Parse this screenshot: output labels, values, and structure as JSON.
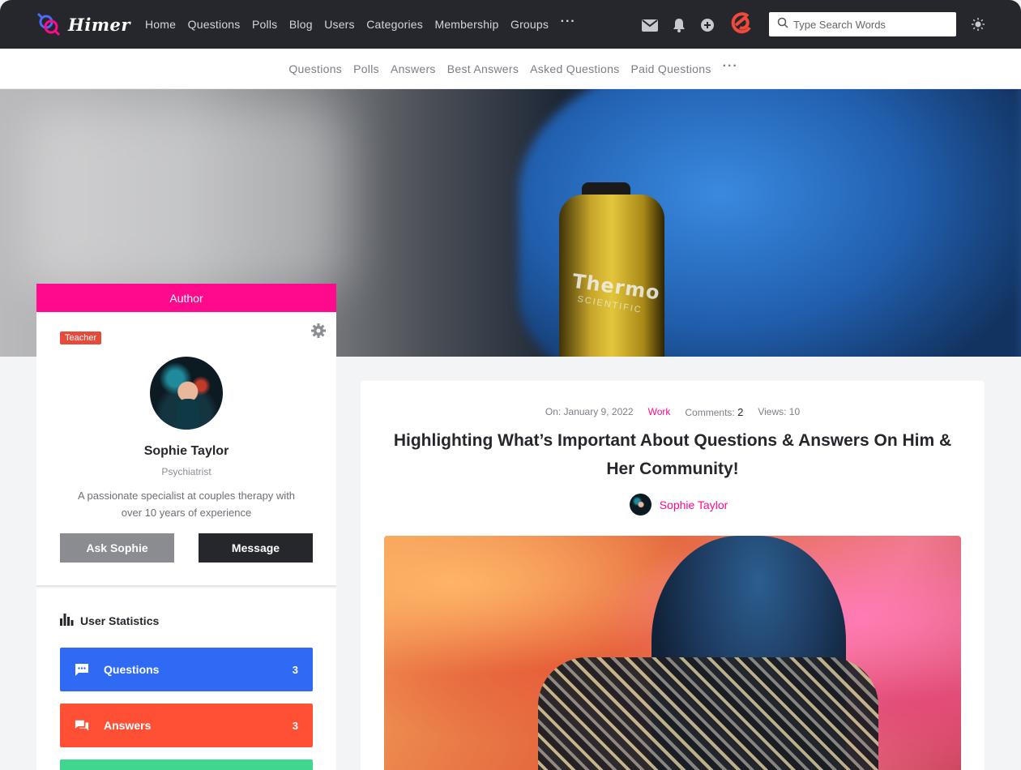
{
  "app": {
    "logo_text": "Himer"
  },
  "nav": {
    "items": [
      "Home",
      "Questions",
      "Polls",
      "Blog",
      "Users",
      "Categories",
      "Membership",
      "Groups"
    ],
    "more": "···"
  },
  "search": {
    "placeholder": "Type Search Words"
  },
  "subnav": {
    "items": [
      "Questions",
      "Polls",
      "Answers",
      "Best Answers",
      "Asked Questions",
      "Paid Questions"
    ],
    "more": "···"
  },
  "hero": {
    "bottle_label": "Thermo",
    "bottle_sublabel": "SCIENTIFIC"
  },
  "author": {
    "header": "Author",
    "badge": "Teacher",
    "name": "Sophie Taylor",
    "role": "Psychiatrist",
    "bio": "A passionate specialist at couples therapy with over 10 years of experience",
    "ask_label": "Ask Sophie",
    "message_label": "Message"
  },
  "stats": {
    "title": "User Statistics",
    "items": [
      {
        "label": "Questions",
        "count": "3"
      },
      {
        "label": "Answers",
        "count": "3"
      }
    ]
  },
  "post": {
    "date": "On: January 9, 2022",
    "category": "Work",
    "comments_label": "Comments:",
    "comments_count": "2",
    "views": "Views: 10",
    "title": "Highlighting What’s Important About Questions & Answers On Him & Her Community!",
    "author": "Sophie Taylor"
  },
  "colors": {
    "topbar": "#26272c",
    "accent_pink": "#ff0a8c",
    "badge_red": "#e64a3b",
    "stat_blue": "#2f6af5",
    "stat_orange": "#ff5036",
    "stat_green": "#41d690"
  },
  "icons": [
    "mail-icon",
    "bell-icon",
    "plus-circle-icon",
    "brand-icon",
    "search-icon",
    "sun-icon",
    "gear-icon",
    "bar-chart-icon",
    "chat-icon",
    "answers-icon"
  ]
}
